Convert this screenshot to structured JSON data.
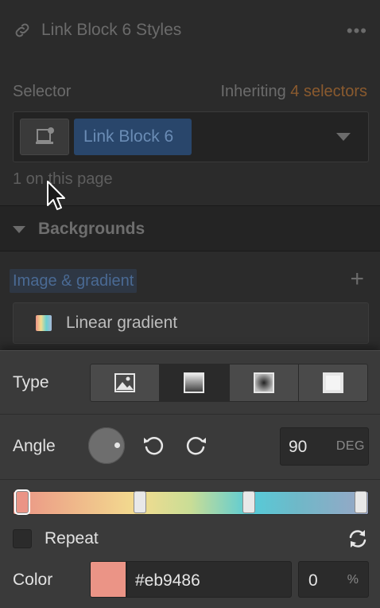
{
  "header": {
    "title": "Link Block 6 Styles",
    "more_label": "•••"
  },
  "selector": {
    "label": "Selector",
    "inheriting_prefix": "Inheriting ",
    "inheriting_count": "4 selectors",
    "chip": "Link Block 6",
    "on_page": "1 on this page"
  },
  "backgrounds": {
    "section_title": "Backgrounds",
    "layer_type_label": "Image & gradient",
    "add_label": "+",
    "layer_name": "Linear gradient"
  },
  "gradient_editor": {
    "type_label": "Type",
    "type_options": [
      "image",
      "linear-gradient",
      "radial-gradient",
      "solid-color"
    ],
    "type_selected": "linear-gradient",
    "angle_label": "Angle",
    "angle_value": "90",
    "angle_unit": "DEG",
    "stops": [
      {
        "color": "#eb9486",
        "position": 0.0,
        "selected": true
      },
      {
        "color": "#f3dc8f",
        "position": 0.35
      },
      {
        "color": "#56cbd8",
        "position": 0.67
      },
      {
        "color": "#9aa6c6",
        "position": 1.0
      }
    ],
    "repeat_label": "Repeat",
    "repeat_checked": false,
    "color_label": "Color",
    "color_hex": "#eb9486",
    "position_value": "0",
    "position_unit": "%"
  },
  "icons": [
    "link-icon",
    "more-icon",
    "element-icon",
    "caret-down-icon",
    "cursor-icon",
    "triangle-down-icon",
    "plus-icon",
    "gradient-swatch-icon",
    "image-icon",
    "linear-gradient-icon",
    "radial-gradient-icon",
    "solid-color-icon",
    "rotate-left-icon",
    "rotate-right-icon",
    "reverse-icon"
  ]
}
